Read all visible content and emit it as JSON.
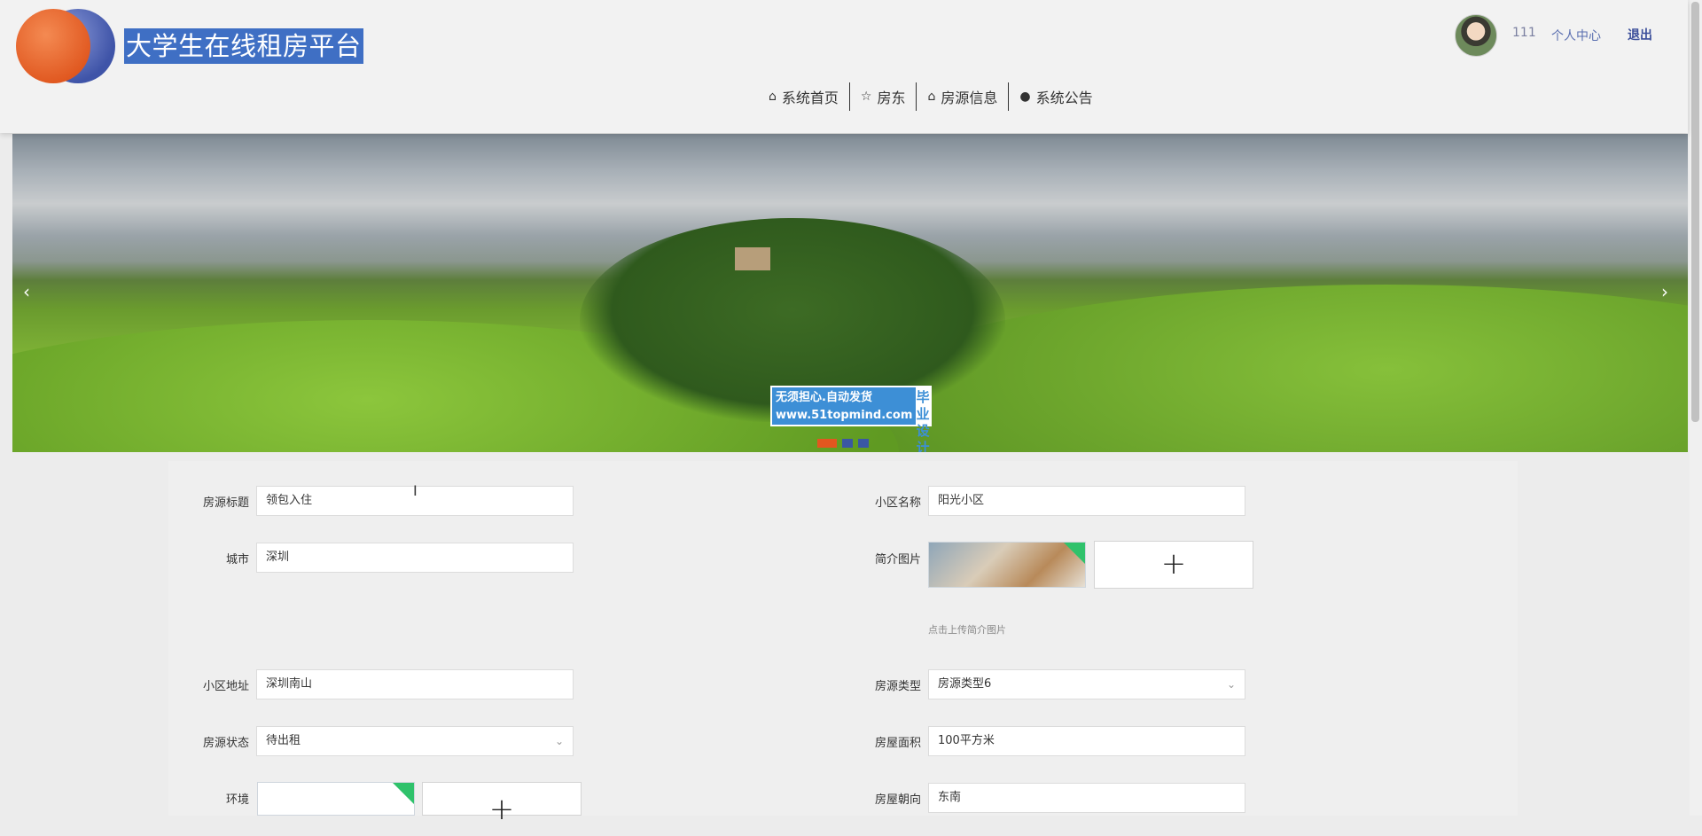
{
  "header": {
    "site_title": "大学生在线租房平台",
    "username": "111",
    "profile_label": "个人中心",
    "logout_label": "退出"
  },
  "nav": [
    {
      "label": "系统首页",
      "icon": "home-icon"
    },
    {
      "label": "房东",
      "icon": "star-icon"
    },
    {
      "label": "房源信息",
      "icon": "bag-icon"
    },
    {
      "label": "系统公告",
      "icon": "alert-icon"
    }
  ],
  "banner": {
    "watermark_line1": "无须担心.自动发货",
    "watermark_line2": "www.51topmind.com",
    "watermark_badge": "毕业设计",
    "slide_count": 3,
    "active_slide": 1,
    "prev_arrow": "‹",
    "next_arrow": "›"
  },
  "form": {
    "title_label": "房源标题",
    "title_value": "领包入住",
    "community_label": "小区名称",
    "community_value": "阳光小区",
    "city_label": "城市",
    "city_value": "深圳",
    "intro_image_label": "简介图片",
    "intro_upload_hint": "点击上传简介图片",
    "address_label": "小区地址",
    "address_value": "深圳南山",
    "type_label": "房源类型",
    "type_value": "房源类型6",
    "status_label": "房源状态",
    "status_value": "待出租",
    "area_label": "房屋面积",
    "area_value": "100平方米",
    "environment_label": "环境",
    "orientation_label": "房屋朝向",
    "orientation_value": "东南",
    "upload_plus": "+"
  }
}
